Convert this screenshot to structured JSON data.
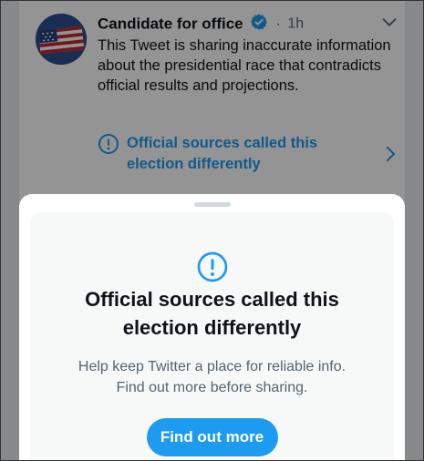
{
  "tweet": {
    "author_name": "Candidate for office",
    "separator": "·",
    "timestamp": "1h",
    "text": "This Tweet is sharing inaccurate information about the presidential race that contradicts official results and projections.",
    "warning_label": "Official sources called this election differently",
    "avatar": "us-flag",
    "icons": {
      "verified": "verified-badge-icon",
      "menu": "chevron-down-icon",
      "warning": "exclamation-circle-icon",
      "open": "chevron-right-icon"
    }
  },
  "sheet": {
    "icon": "exclamation-circle-icon",
    "title": "Official sources called this election differently",
    "body_line1": "Help keep Twitter a place for reliable info.",
    "body_line2": "Find out more before sharing.",
    "button_label": "Find out more"
  },
  "colors": {
    "accent": "#1d9bf0",
    "text_primary": "#0f1419",
    "text_secondary": "#536471",
    "overlay": "rgba(0,0,0,0.42)",
    "card_bg": "#f7f9f9"
  }
}
